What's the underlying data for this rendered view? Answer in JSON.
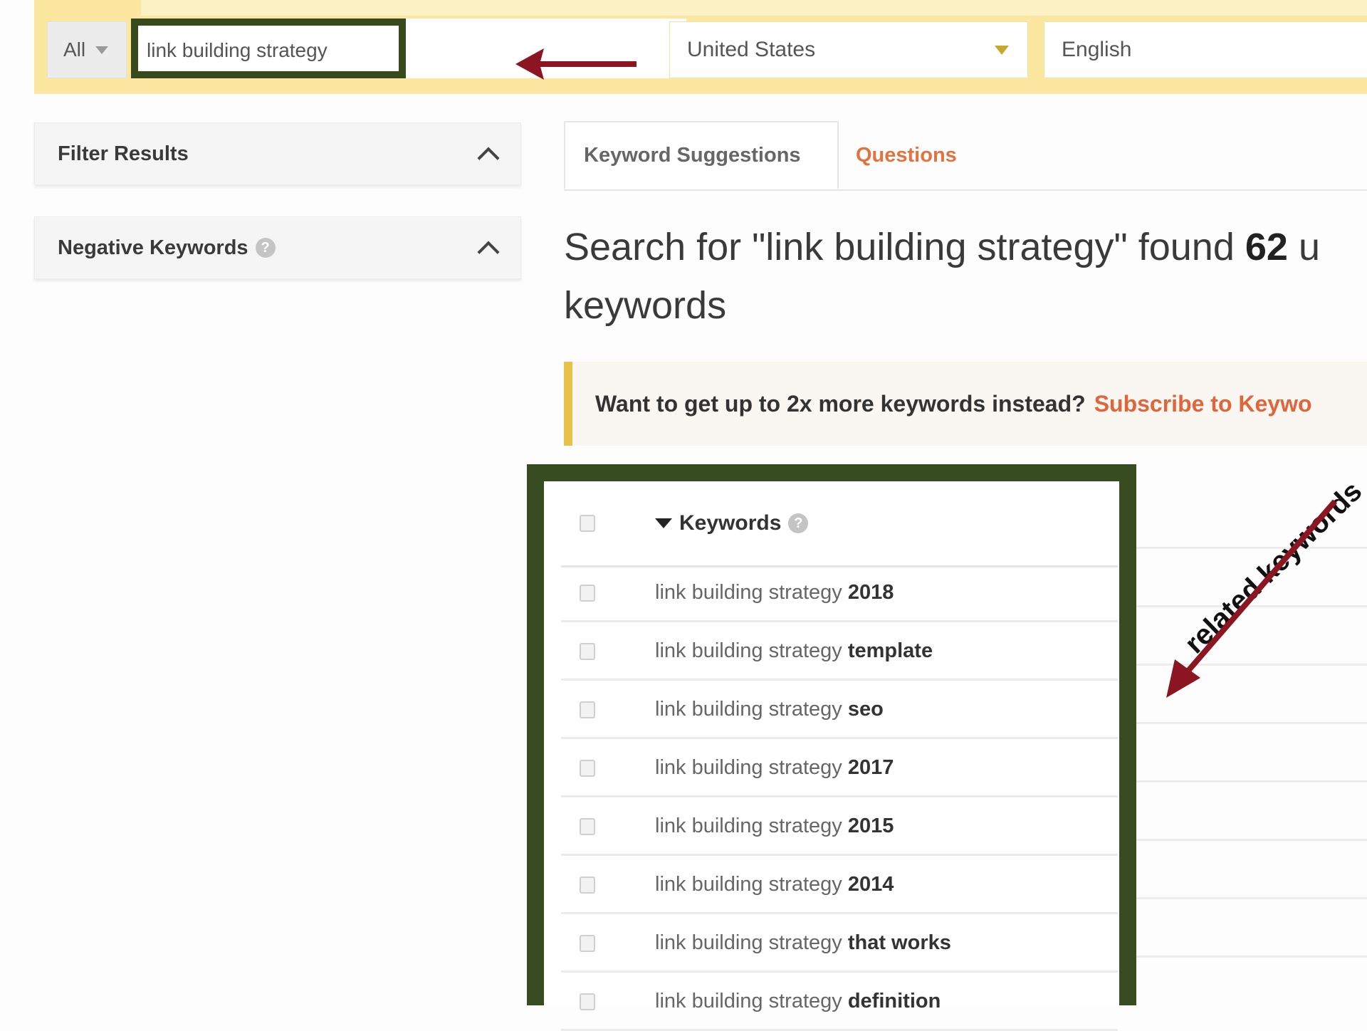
{
  "search_bar": {
    "type_select": "All",
    "query": "link building strategy",
    "country": "United States",
    "language": "English"
  },
  "sidebar": {
    "panels": [
      {
        "title": "Filter Results",
        "has_help": false
      },
      {
        "title": "Negative Keywords",
        "has_help": true
      }
    ]
  },
  "tabs": [
    {
      "label": "Keyword Suggestions",
      "active": true
    },
    {
      "label": "Questions",
      "active": false
    }
  ],
  "headline": {
    "prefix": "Search for \"link building strategy\" found ",
    "count": "62",
    "suffix_line1": " u",
    "line2": "keywords"
  },
  "promo": {
    "text": "Want to get up to 2x more keywords instead?",
    "link": "Subscribe to Keywo"
  },
  "table": {
    "column_header": "Keywords",
    "base_phrase": "link building strategy",
    "rows": [
      {
        "suffix": "2018"
      },
      {
        "suffix": "template"
      },
      {
        "suffix": "seo"
      },
      {
        "suffix": "2017"
      },
      {
        "suffix": "2015"
      },
      {
        "suffix": "2014"
      },
      {
        "suffix": "that works"
      },
      {
        "suffix": "definition"
      }
    ]
  },
  "annotation": {
    "label": "related keywords",
    "color": "#8b1520",
    "highlight_color": "#384c21"
  },
  "colors": {
    "topbar": "#fbe7a0",
    "accent_orange": "#e0653a",
    "promo_bar": "#e6c24a"
  }
}
